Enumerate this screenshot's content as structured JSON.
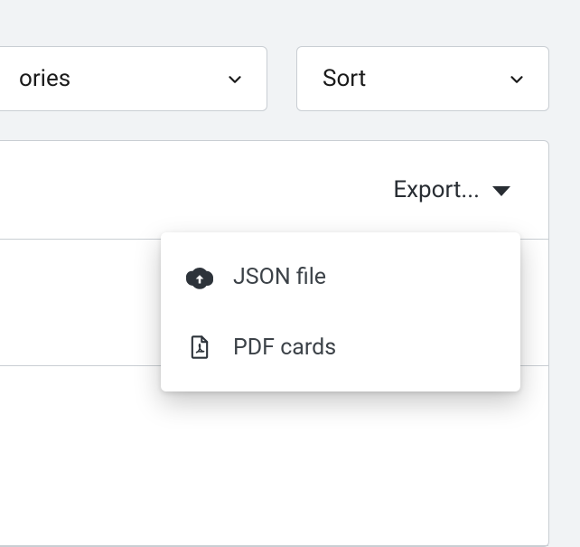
{
  "filters": {
    "categories": {
      "label": "ories"
    },
    "sort": {
      "label": "Sort"
    }
  },
  "export": {
    "trigger_label": "Export...",
    "menu": {
      "json": {
        "label": "JSON file"
      },
      "pdf": {
        "label": "PDF cards"
      }
    }
  }
}
